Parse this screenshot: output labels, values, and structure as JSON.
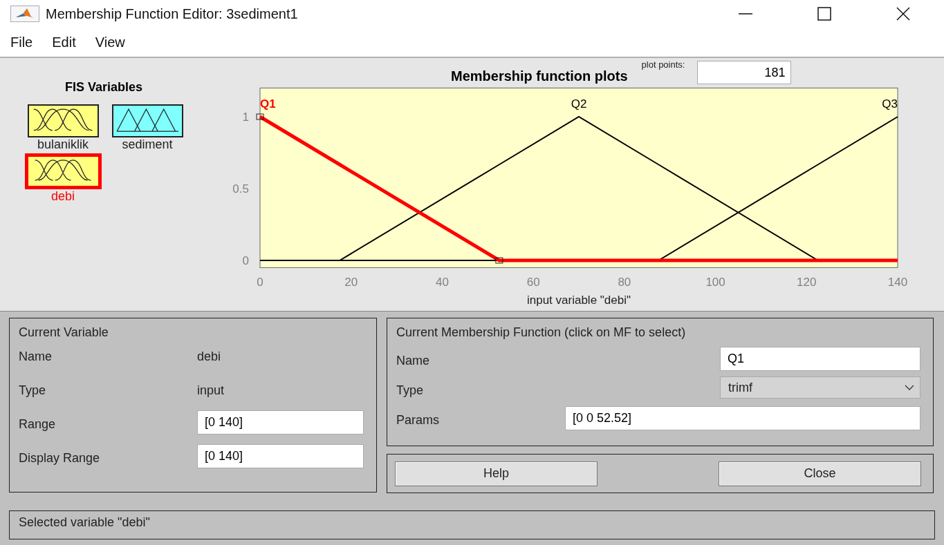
{
  "window": {
    "title": "Membership Function Editor: 3sediment1"
  },
  "menu": [
    "File",
    "Edit",
    "View"
  ],
  "fis_variables": {
    "title": "FIS Variables",
    "items": [
      {
        "name": "bulaniklik",
        "kind": "input",
        "selected": false
      },
      {
        "name": "sediment",
        "kind": "output",
        "selected": false
      },
      {
        "name": "debi",
        "kind": "input",
        "selected": true
      }
    ]
  },
  "plot": {
    "title": "Membership function plots",
    "plot_points_label": "plot points:",
    "plot_points": "181",
    "chart_data": {
      "type": "line",
      "xlabel": "input variable \"debi\"",
      "x": [
        0,
        17.5,
        52.52,
        70,
        87.5,
        122.5,
        140
      ],
      "series": [
        {
          "name": "Q1",
          "color": "#ff0000",
          "values": [
            1,
            0.667,
            0,
            0,
            0,
            0,
            0
          ]
        },
        {
          "name": "Q2",
          "color": "#000000",
          "values": [
            0,
            0,
            0.667,
            1,
            0.667,
            0,
            0
          ]
        },
        {
          "name": "Q3",
          "color": "#000000",
          "values": [
            0,
            0,
            0,
            0,
            0,
            0.667,
            1
          ]
        }
      ],
      "xlim": [
        0,
        140
      ],
      "ylim": [
        -0.05,
        1.2
      ],
      "xticks": [
        0,
        20,
        40,
        60,
        80,
        100,
        120,
        140
      ],
      "yticks": [
        0,
        0.5,
        1
      ]
    },
    "mf_states": [
      {
        "selected": true
      },
      {
        "selected": false
      },
      {
        "selected": false
      }
    ]
  },
  "current_variable": {
    "title": "Current Variable",
    "rows": [
      {
        "label": "Name",
        "kind": "text",
        "value": "debi"
      },
      {
        "label": "Type",
        "kind": "text",
        "value": "input"
      },
      {
        "label": "Range",
        "kind": "field",
        "value": "[0 140]"
      },
      {
        "label": "Display Range",
        "kind": "field",
        "value": "[0 140]"
      }
    ]
  },
  "current_mf": {
    "title": "Current Membership Function (click on MF to select)",
    "name_label": "Name",
    "name": "Q1",
    "type_label": "Type",
    "type": "trimf",
    "params_label": "Params",
    "params": "[0 0 52.52]"
  },
  "buttons": [
    "Help",
    "Close"
  ],
  "status": "Selected variable \"debi\""
}
